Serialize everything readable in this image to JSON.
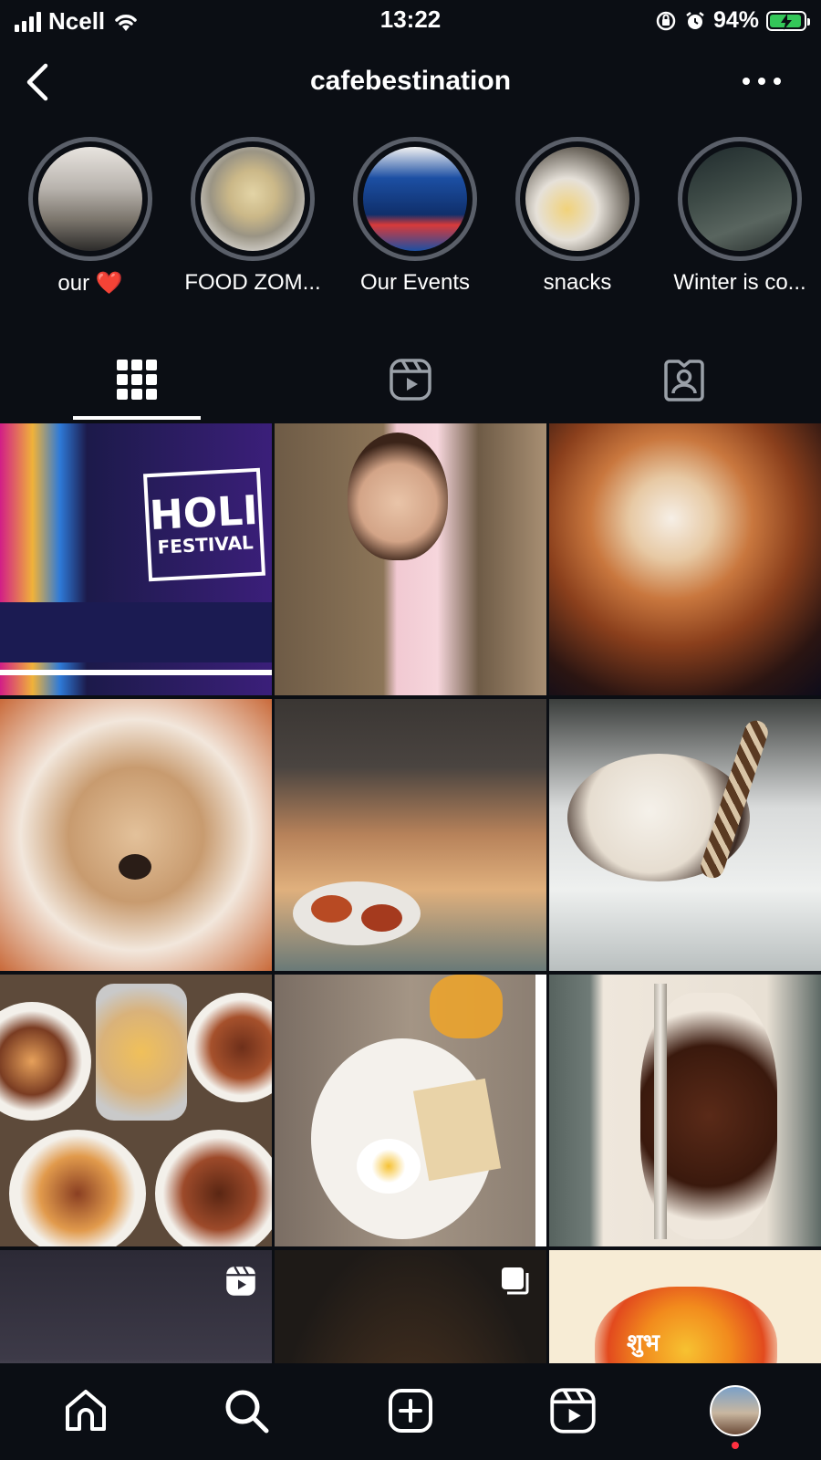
{
  "status_bar": {
    "carrier": "Ncell",
    "time": "13:22",
    "battery_percent": "94%",
    "battery_level": 0.94
  },
  "header": {
    "username": "cafebestination"
  },
  "highlights": [
    {
      "label": "our ❤️",
      "icon": "heart"
    },
    {
      "label": "FOOD ZOM..."
    },
    {
      "label": "Our Events"
    },
    {
      "label": "snacks"
    },
    {
      "label": "Winter is co..."
    }
  ],
  "tabs": [
    {
      "name": "posts-grid",
      "icon": "grid-icon",
      "active": true
    },
    {
      "name": "reels",
      "icon": "reels-icon",
      "active": false
    },
    {
      "name": "tagged",
      "icon": "tagged-icon",
      "active": false
    }
  ],
  "grid": [
    {
      "subject": "Holi Festival poster",
      "type": "photo"
    },
    {
      "subject": "Woman in pink blazer",
      "type": "photo"
    },
    {
      "subject": "Latte art coffee",
      "type": "photo"
    },
    {
      "subject": "Chihuahua",
      "type": "photo"
    },
    {
      "subject": "Momos",
      "type": "photo"
    },
    {
      "subject": "Ice cream sundae",
      "type": "photo"
    },
    {
      "subject": "Platters with fries",
      "type": "photo"
    },
    {
      "subject": "Breakfast plate",
      "type": "photo"
    },
    {
      "subject": "Grilled meat",
      "type": "photo"
    },
    {
      "subject": "Reel",
      "type": "reel"
    },
    {
      "subject": "Candles",
      "type": "carousel"
    },
    {
      "subject": "Festive artwork",
      "type": "photo"
    }
  ],
  "poster_text": {
    "line1": "HOLI",
    "line2": "FESTIVAL"
  },
  "festive_text": "शुभ",
  "bottom_nav": [
    {
      "name": "home",
      "icon": "home-icon"
    },
    {
      "name": "search",
      "icon": "search-icon"
    },
    {
      "name": "create",
      "icon": "plus-square-icon"
    },
    {
      "name": "reels",
      "icon": "reels-icon"
    },
    {
      "name": "profile",
      "icon": "avatar"
    }
  ],
  "colors": {
    "background": "#0b0e14",
    "ring": "#5a5f69",
    "battery_green": "#34c759",
    "notification_dot": "#ff3040"
  }
}
